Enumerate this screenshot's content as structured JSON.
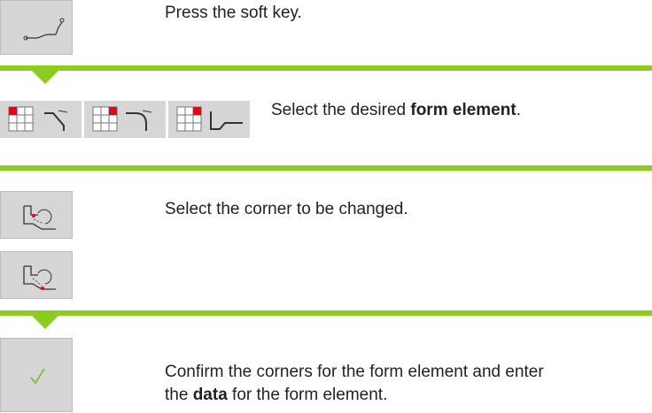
{
  "steps": [
    {
      "text": "Press the soft key."
    },
    {
      "before": "Select the desired ",
      "bold": "form element",
      "after": "."
    },
    {
      "text": "Select the corner to be changed."
    },
    {
      "line1": "Confirm the corners for the form element and enter",
      "line2_before": "the ",
      "line2_bold": "data",
      "line2_after": " for the form element."
    }
  ],
  "colors": {
    "accent": "#8ccc1e",
    "key_bg": "#d6d6d6",
    "marker": "#e30613",
    "check": "#7ac142"
  },
  "icons": [
    "contour-edit-icon",
    "chamfer-icon",
    "rounding-icon",
    "undercut-icon",
    "corner-select-prev-icon",
    "corner-select-next-icon",
    "confirm-check-icon"
  ]
}
